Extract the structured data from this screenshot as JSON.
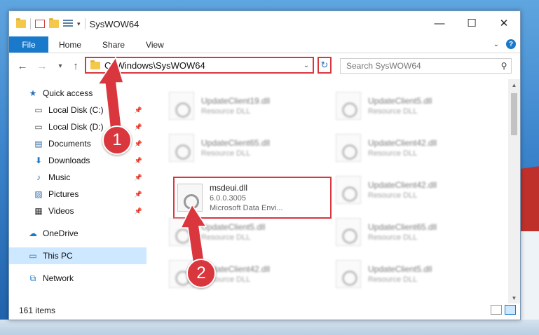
{
  "window": {
    "title": "SysWOW64"
  },
  "controls": {
    "minimize": "—",
    "maximize": "☐",
    "close": "✕"
  },
  "ribbon": {
    "file": "File",
    "tabs": [
      "Home",
      "Share",
      "View"
    ]
  },
  "nav": {
    "back": "←",
    "forward": "→",
    "up": "↑",
    "address": "C:\\Windows\\SysWOW64",
    "refresh": "↻",
    "search_placeholder": "Search SysWOW64"
  },
  "sidebar": {
    "quick_access": "Quick access",
    "items": [
      "Local Disk (C:)",
      "Local Disk (D:)",
      "Documents",
      "Downloads",
      "Music",
      "Pictures",
      "Videos"
    ],
    "onedrive": "OneDrive",
    "thispc": "This PC",
    "network": "Network"
  },
  "files": [
    {
      "name": "UpdateClient19.dll",
      "desc": "Resource DLL"
    },
    {
      "name": "UpdateClient5.dll",
      "desc": "Resource DLL"
    },
    {
      "name": "UpdateClient65.dll",
      "desc": "Resource DLL"
    },
    {
      "name": "UpdateClient42.dll",
      "desc": "Resource DLL"
    },
    {
      "name": "msdeui.dll",
      "version": "6.0.0.3005",
      "desc": "Microsoft Data Envi..."
    },
    {
      "name": "UpdateClient42.dll",
      "desc": "Resource DLL"
    },
    {
      "name": "UpdateClient5.dll",
      "desc": "Resource DLL"
    },
    {
      "name": "UpdateClient65.dll",
      "desc": "Resource DLL"
    },
    {
      "name": "UpdateClient42.dll",
      "desc": "Resource DLL"
    },
    {
      "name": "UpdateClient5.dll",
      "desc": "Resource DLL"
    }
  ],
  "status": {
    "items": "161 items"
  },
  "annotations": {
    "step1": "1",
    "step2": "2"
  },
  "colors": {
    "accent": "#1979ca",
    "highlight": "#d9363e"
  }
}
